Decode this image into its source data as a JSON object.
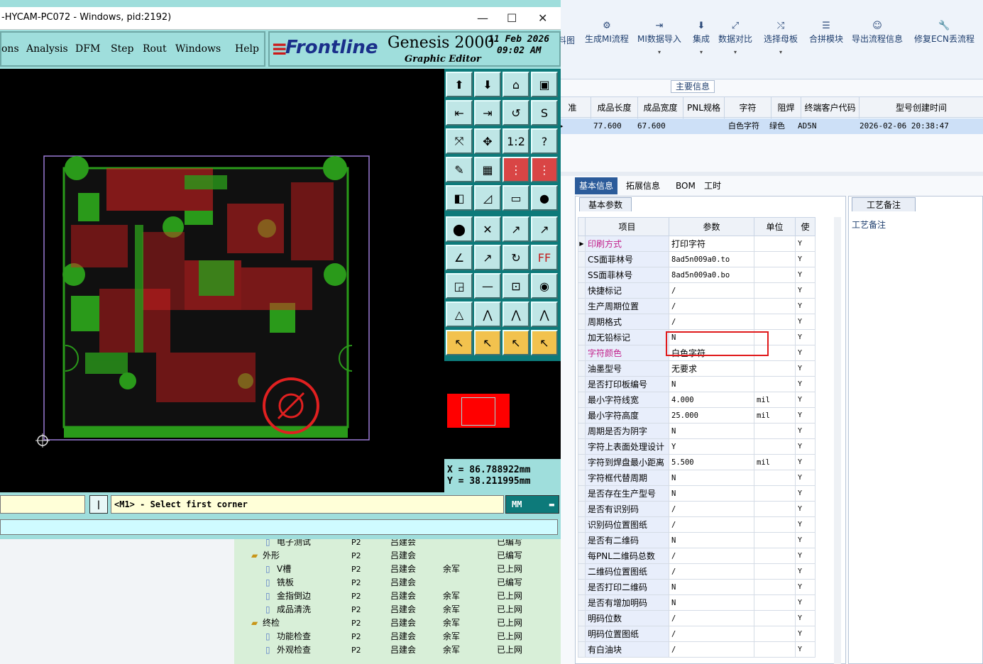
{
  "genesis": {
    "title": "-HYCAM-PC072 - Windows, pid:2192)",
    "menu": [
      "ons",
      "Analysis",
      "DFM",
      "Step",
      "Rout",
      "Windows",
      "Help"
    ],
    "brand": "Frontline",
    "product": "Genesis 2000",
    "subtitle": "Graphic Editor",
    "date": "11 Feb 2026",
    "time": "09:02 AM",
    "coord_x": "X = 86.788922mm",
    "coord_y": "Y = 38.211995mm",
    "status_msg": "<M1> - Select first corner",
    "unit": "MM",
    "status_btn": "|",
    "tb_labels": {
      "ratio": "1:2",
      "help": "?",
      "ff": "FF"
    }
  },
  "ribbon": {
    "partial": "料图",
    "items": [
      {
        "label": "生成MI流程",
        "icon": "⚙",
        "dd": false
      },
      {
        "label": "MI数据导入",
        "icon": "⇥",
        "dd": true
      },
      {
        "label": "集成",
        "icon": "⬇",
        "dd": true
      },
      {
        "label": "数据对比",
        "icon": "⤢",
        "dd": true
      },
      {
        "label": "选择母板",
        "icon": "⤭",
        "dd": true
      },
      {
        "label": "合拼模块",
        "icon": "☰",
        "dd": false
      },
      {
        "label": "导出流程信息",
        "icon": "☺",
        "dd": false
      },
      {
        "label": "修复ECN丢流程",
        "icon": "🔧",
        "dd": false
      }
    ],
    "main_info": "主要信息"
  },
  "grid": {
    "headers": [
      "准",
      "成品长度",
      "成品宽度",
      "PNL规格",
      "字符",
      "阻焊",
      "终端客户代码",
      "型号创建时间"
    ],
    "row": [
      "▸",
      "77.600",
      "67.600",
      "",
      "白色字符",
      "绿色",
      "AD5N",
      "2026-02-06 20:38:47"
    ]
  },
  "tabs": [
    "基本信息",
    "拓展信息",
    "BOM",
    "工时"
  ],
  "sub_tab": "基本参数",
  "notes_tab": "工艺备注",
  "notes_label": "工艺备注",
  "param_headers": [
    "项目",
    "参数",
    "单位",
    "使"
  ],
  "params": [
    {
      "name": "印刷方式",
      "val": "打印字符",
      "unit": "",
      "flag": "Y",
      "pink": true,
      "cn": true
    },
    {
      "name": "CS面菲林号",
      "val": "8ad5n009a0.to",
      "unit": "",
      "flag": "Y"
    },
    {
      "name": "SS面菲林号",
      "val": "8ad5n009a0.bo",
      "unit": "",
      "flag": "Y"
    },
    {
      "name": "快捷标记",
      "val": "/",
      "unit": "",
      "flag": "Y"
    },
    {
      "name": "生产周期位置",
      "val": "/",
      "unit": "",
      "flag": "Y"
    },
    {
      "name": "周期格式",
      "val": "/",
      "unit": "",
      "flag": "Y"
    },
    {
      "name": "加无铅标记",
      "val": "N",
      "unit": "",
      "flag": "Y"
    },
    {
      "name": "字符颜色",
      "val": "白色字符",
      "unit": "",
      "flag": "Y",
      "pink": true,
      "cn": true
    },
    {
      "name": "油墨型号",
      "val": "无要求",
      "unit": "",
      "flag": "Y",
      "cn": true
    },
    {
      "name": "是否打印板编号",
      "val": "N",
      "unit": "",
      "flag": "Y"
    },
    {
      "name": "最小字符线宽",
      "val": "4.000",
      "unit": "mil",
      "flag": "Y"
    },
    {
      "name": "最小字符高度",
      "val": "25.000",
      "unit": "mil",
      "flag": "Y"
    },
    {
      "name": "周期是否为阴字",
      "val": "N",
      "unit": "",
      "flag": "Y"
    },
    {
      "name": "字符上表面处理设计",
      "val": "Y",
      "unit": "",
      "flag": "Y"
    },
    {
      "name": "字符到焊盘最小距离",
      "val": "5.500",
      "unit": "mil",
      "flag": "Y"
    },
    {
      "name": "字符框代替周期",
      "val": "N",
      "unit": "",
      "flag": "Y"
    },
    {
      "name": "是否存在生产型号",
      "val": "N",
      "unit": "",
      "flag": "Y"
    },
    {
      "name": "是否有识别码",
      "val": "/",
      "unit": "",
      "flag": "Y"
    },
    {
      "name": "识别码位置图纸",
      "val": "/",
      "unit": "",
      "flag": "Y"
    },
    {
      "name": "是否有二维码",
      "val": "N",
      "unit": "",
      "flag": "Y"
    },
    {
      "name": "每PNL二维码总数",
      "val": "/",
      "unit": "",
      "flag": "Y"
    },
    {
      "name": "二维码位置图纸",
      "val": "/",
      "unit": "",
      "flag": "Y"
    },
    {
      "name": "是否打印二维码",
      "val": "N",
      "unit": "",
      "flag": "Y"
    },
    {
      "name": "是否有增加明码",
      "val": "N",
      "unit": "",
      "flag": "Y"
    },
    {
      "name": "明码位数",
      "val": "/",
      "unit": "",
      "flag": "Y"
    },
    {
      "name": "明码位置图纸",
      "val": "/",
      "unit": "",
      "flag": "Y"
    },
    {
      "name": "有白油块",
      "val": "/",
      "unit": "",
      "flag": "Y"
    }
  ],
  "tree": [
    {
      "indent": 1,
      "name": "电子测试",
      "c1": "P2",
      "c2": "吕建会",
      "c3": "",
      "c4": "已编写",
      "folder": false
    },
    {
      "indent": 0,
      "name": "外形",
      "c1": "P2",
      "c2": "吕建会",
      "c3": "",
      "c4": "已编写",
      "folder": true
    },
    {
      "indent": 1,
      "name": "V槽",
      "c1": "P2",
      "c2": "吕建会",
      "c3": "余军",
      "c4": "已上网",
      "folder": false
    },
    {
      "indent": 1,
      "name": "铣板",
      "c1": "P2",
      "c2": "吕建会",
      "c3": "",
      "c4": "已编写",
      "folder": false
    },
    {
      "indent": 1,
      "name": "金指倒边",
      "c1": "P2",
      "c2": "吕建会",
      "c3": "余军",
      "c4": "已上网",
      "folder": false
    },
    {
      "indent": 1,
      "name": "成品清洗",
      "c1": "P2",
      "c2": "吕建会",
      "c3": "余军",
      "c4": "已上网",
      "folder": false
    },
    {
      "indent": 0,
      "name": "终检",
      "c1": "P2",
      "c2": "吕建会",
      "c3": "余军",
      "c4": "已上网",
      "folder": true
    },
    {
      "indent": 1,
      "name": "功能检查",
      "c1": "P2",
      "c2": "吕建会",
      "c3": "余军",
      "c4": "已上网",
      "folder": false
    },
    {
      "indent": 1,
      "name": "外观检查",
      "c1": "P2",
      "c2": "吕建会",
      "c3": "余军",
      "c4": "已上网",
      "folder": false
    }
  ],
  "colors": {
    "accent": "#2b5b9a",
    "highlight_box": "#e0191b",
    "pcb_green": "#2a9a1a",
    "pcb_red": "#e02020"
  }
}
